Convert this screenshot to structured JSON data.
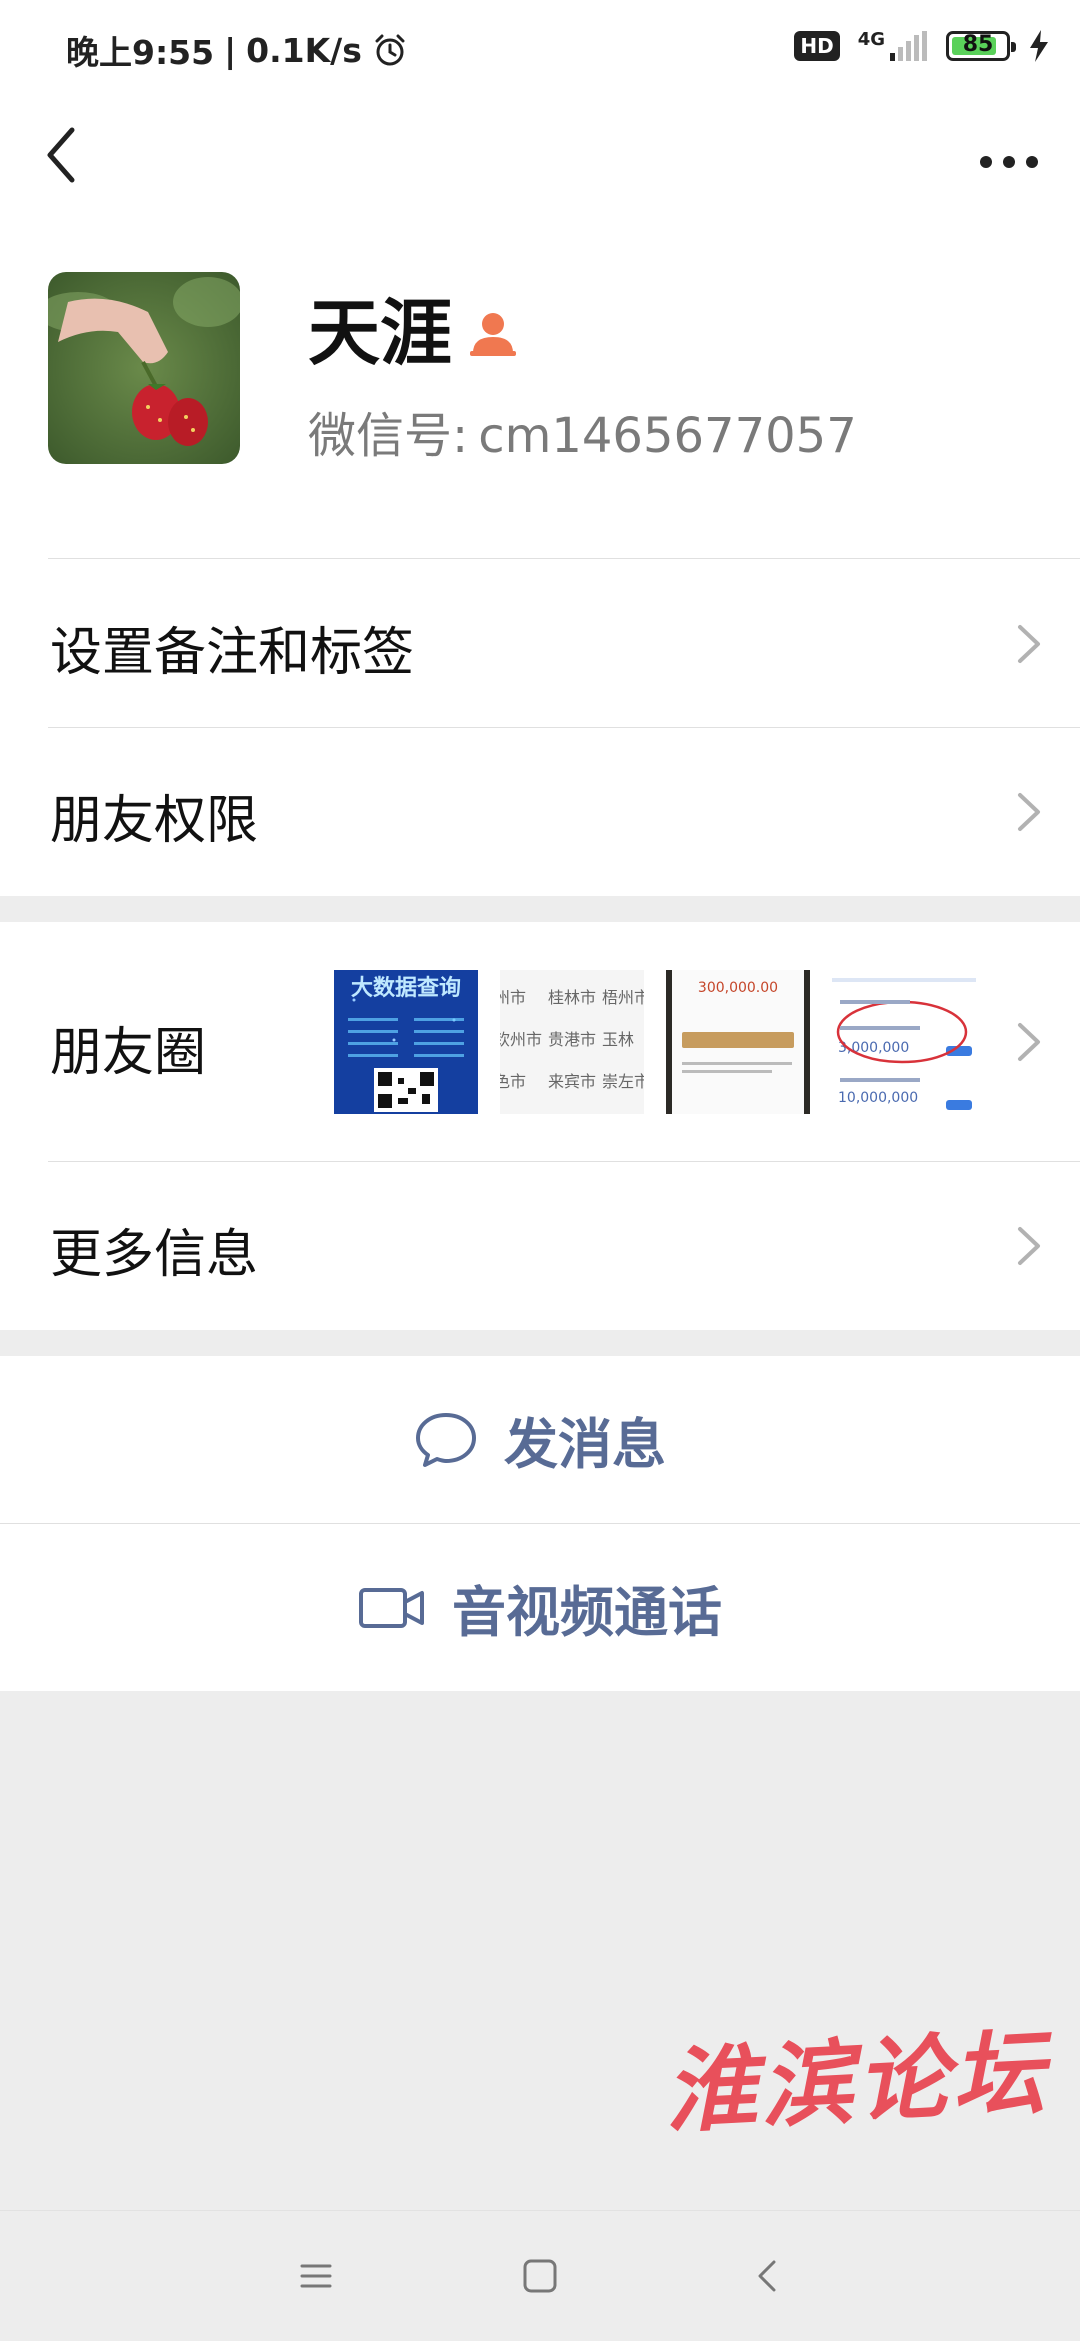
{
  "status_bar": {
    "time": "晚上9:55",
    "speed": "0.1K/s",
    "hd": "HD",
    "network": "4G",
    "battery": "85",
    "battery_level": 0.85
  },
  "profile": {
    "name": "天涯",
    "wechat_id_label": "微信号:",
    "wechat_id": "cm1465677057"
  },
  "menu": {
    "remarks_tags": "设置备注和标签",
    "friend_permissions": "朋友权限",
    "moments": "朋友圈",
    "more_info": "更多信息"
  },
  "moments_thumbs": {
    "thumb1_title": "大数据查询",
    "thumb2_cities": [
      "州市",
      "桂林市",
      "梧州市",
      "钦州市",
      "贵港市",
      "玉林",
      "色市",
      "来宾市",
      "崇左市"
    ],
    "thumb3_amount": "300,000.00",
    "thumb4_amount1": "3,000,000",
    "thumb4_amount2": "10,000,000"
  },
  "actions": {
    "send_message": "发消息",
    "video_call": "音视频通话"
  },
  "watermark": "淮滨论坛",
  "colors": {
    "action_blue": "#586b95",
    "background_gray": "#ededed",
    "watermark_red": "#e8505b",
    "badge_orange": "#f07850"
  }
}
